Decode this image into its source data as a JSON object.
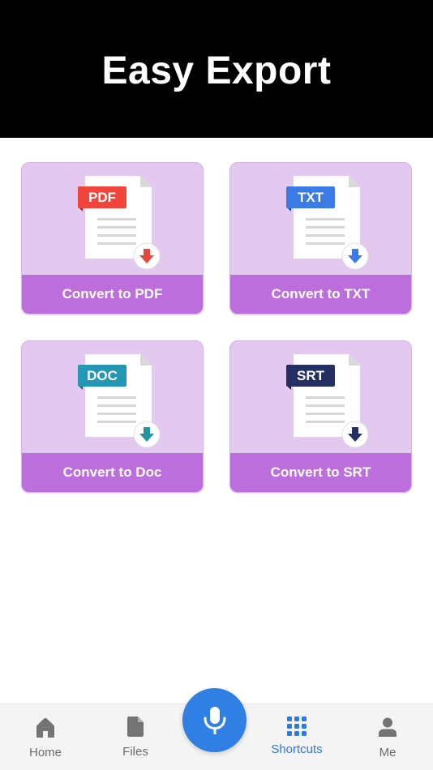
{
  "header": {
    "title": "Easy Export"
  },
  "cards": [
    {
      "badge": "PDF",
      "label": "Convert to PDF",
      "badge_color": "#f2443b",
      "arrow_color": "#e9463c"
    },
    {
      "badge": "TXT",
      "label": "Convert to TXT",
      "badge_color": "#3a7be6",
      "arrow_color": "#3a7be6"
    },
    {
      "badge": "DOC",
      "label": "Convert to Doc",
      "badge_color": "#2497b5",
      "arrow_color": "#21949e"
    },
    {
      "badge": "SRT",
      "label": "Convert to SRT",
      "badge_color": "#233061",
      "arrow_color": "#233061"
    }
  ],
  "nav": {
    "items": [
      {
        "label": "Home",
        "icon": "home-icon"
      },
      {
        "label": "Files",
        "icon": "file-icon"
      },
      {
        "label": "Shortcuts",
        "icon": "grid-icon",
        "active": true
      },
      {
        "label": "Me",
        "icon": "person-icon"
      }
    ],
    "mic_icon": "microphone-icon"
  },
  "colors": {
    "header_bg": "#000000",
    "card_bg": "#e3c9ef",
    "card_label_bg": "#bc6edc",
    "accent": "#2f7fe4",
    "nav_bg": "#f4f4f4"
  }
}
